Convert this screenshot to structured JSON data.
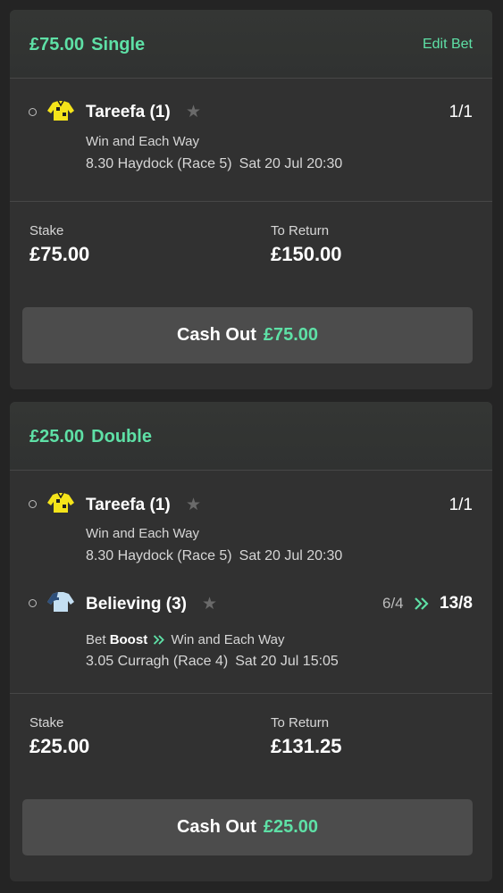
{
  "bets": [
    {
      "amount": "£75.00",
      "type": "Single",
      "edit_label": "Edit Bet",
      "selections": [
        {
          "horse": "Tareefa (1)",
          "odds": "1/1",
          "market": "Win and Each Way",
          "race": "8.30 Haydock (Race 5)",
          "datetime": "Sat 20 Jul 20:30",
          "silk": "yellow-silk"
        }
      ],
      "stake_label": "Stake",
      "stake": "£75.00",
      "return_label": "To Return",
      "return": "£150.00",
      "cashout_label": "Cash Out",
      "cashout_amount": "£75.00"
    },
    {
      "amount": "£25.00",
      "type": "Double",
      "selections": [
        {
          "horse": "Tareefa (1)",
          "odds": "1/1",
          "market": "Win and Each Way",
          "race": "8.30 Haydock (Race 5)",
          "datetime": "Sat 20 Jul 20:30",
          "silk": "yellow-silk"
        },
        {
          "horse": "Believing (3)",
          "old_odds": "6/4",
          "odds": "13/8",
          "boost_prefix": "Bet",
          "boost_word": "Boost",
          "market": "Win and Each Way",
          "race": "3.05 Curragh (Race 4)",
          "datetime": "Sat 20 Jul 15:05",
          "silk": "lightblue-silk"
        }
      ],
      "stake_label": "Stake",
      "stake": "£25.00",
      "return_label": "To Return",
      "return": "£131.25",
      "cashout_label": "Cash Out",
      "cashout_amount": "£25.00"
    }
  ],
  "colors": {
    "accent": "#5ee0a6",
    "background": "#242424",
    "card": "#313131",
    "button": "#4c4c4c"
  }
}
